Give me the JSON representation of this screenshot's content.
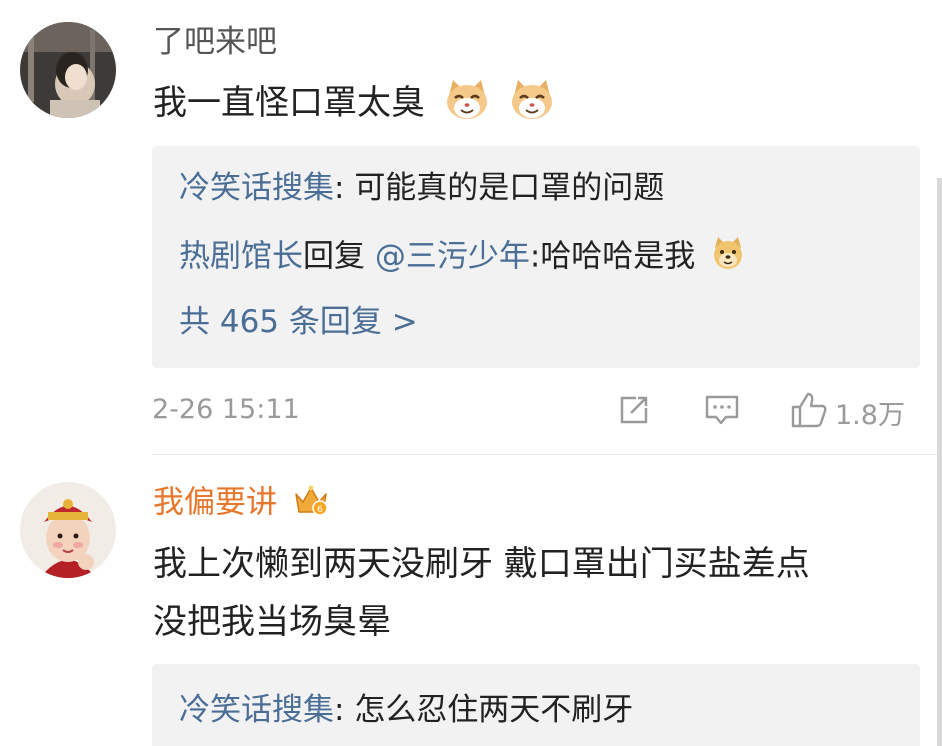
{
  "comments": [
    {
      "username": "了吧来吧",
      "text": "我一直怪口罩太臭",
      "emojis": [
        "cat-face-icon",
        "cat-face-icon"
      ],
      "replies": [
        {
          "author": "冷笑话搜集",
          "separator": ": ",
          "body": "可能真的是口罩的问题"
        },
        {
          "author": "热剧馆长",
          "verb": "回复",
          "mention": "@三污少年",
          "separator": ":",
          "body": "哈哈哈是我",
          "emoji": "doge-icon"
        }
      ],
      "more_replies": "共 465 条回复 >",
      "timestamp": "2-26 15:11",
      "like_count": "1.8万"
    },
    {
      "username": "我偏要讲",
      "badge": "crown-icon",
      "text_line1": "我上次懒到两天没刷牙 戴口罩出门买盐差点",
      "text_line2": "没把我当场臭晕",
      "replies": [
        {
          "author": "冷笑话搜集",
          "separator": ": ",
          "body": "怎么忍住两天不刷牙"
        }
      ]
    }
  ],
  "colors": {
    "link": "#4a6e96",
    "vip_name": "#e8762b",
    "text": "#222222",
    "meta": "#9a9a9a",
    "reply_bg": "#f2f2f2"
  }
}
